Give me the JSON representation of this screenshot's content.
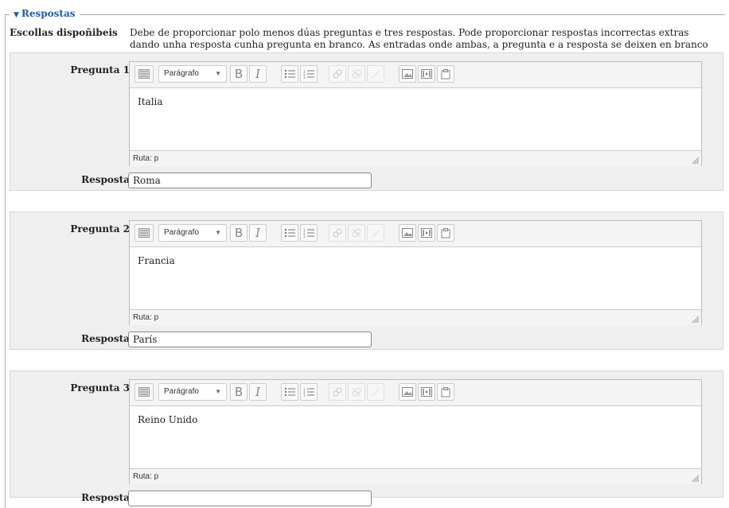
{
  "section": {
    "legend": "Respostas",
    "intro_label": "Escollas dispoñibeis",
    "intro_text": "Debe de proporcionar polo menos dúas preguntas e tres respostas. Pode proporcionar respostas incorrectas extras dando unha resposta cunha pregunta en branco. As entradas onde ambas, a pregunta e a resposta se deixen en branco ignoraranse."
  },
  "toolbar": {
    "format_value": "Parágrafo",
    "bold": "B",
    "italic": "I"
  },
  "status_path": "Ruta: p",
  "answer_label": "Resposta",
  "questions": [
    {
      "label": "Pregunta 1",
      "text": "Italia",
      "answer": "Roma"
    },
    {
      "label": "Pregunta 2",
      "text": "Francia",
      "answer": "París"
    },
    {
      "label": "Pregunta 3",
      "text": "Reino Unido",
      "answer": ""
    }
  ]
}
